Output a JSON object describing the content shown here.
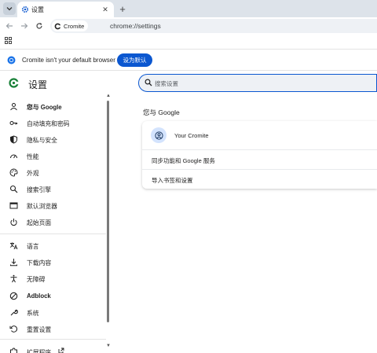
{
  "tabstrip": {
    "menu_icon": "chevron-down-icon",
    "tab_title": "设置",
    "tab_icon": "gear-icon",
    "close_icon": "close-icon",
    "new_tab_symbol": "+"
  },
  "toolbar": {
    "back_icon": "arrow-left-icon",
    "forward_icon": "arrow-right-icon",
    "reload_icon": "reload-icon",
    "site_chip_label": "Cromite",
    "url": "chrome://settings"
  },
  "bookmarks": {
    "apps_icon": "apps-grid-icon"
  },
  "banner": {
    "text": "Cromite isn't your default browser",
    "button_label": "设为默认"
  },
  "header": {
    "title": "设置",
    "search_placeholder": "搜索设置"
  },
  "sidebar": {
    "items": [
      {
        "label": "您与 Google",
        "icon": "person-icon",
        "bold": true
      },
      {
        "label": "自动填充和密码",
        "icon": "key-icon"
      },
      {
        "label": "隐私与安全",
        "icon": "shield-icon"
      },
      {
        "label": "性能",
        "icon": "speedometer-icon"
      },
      {
        "label": "外观",
        "icon": "palette-icon"
      },
      {
        "label": "搜索引擎",
        "icon": "search-icon"
      },
      {
        "label": "默认浏览器",
        "icon": "browser-window-icon"
      },
      {
        "label": "起始页面",
        "icon": "power-icon"
      },
      {
        "label": "语言",
        "icon": "translate-icon"
      },
      {
        "label": "下载内容",
        "icon": "download-icon"
      },
      {
        "label": "无障碍",
        "icon": "accessibility-icon"
      },
      {
        "label": "Adblock",
        "icon": "block-icon",
        "bold": true
      },
      {
        "label": "系统",
        "icon": "wrench-icon"
      },
      {
        "label": "重置设置",
        "icon": "reset-icon"
      },
      {
        "label": "扩展程序",
        "icon": "extension-icon"
      }
    ]
  },
  "main": {
    "section_title": "您与 Google",
    "account_name": "Your Cromite",
    "rows": [
      {
        "label": "同步功能和 Google 服务"
      },
      {
        "label": "导入书签和设置"
      }
    ]
  },
  "colors": {
    "accent": "#0b57d0",
    "tabstrip_bg": "#dde3ea",
    "omnibox_bg": "#eef1f5",
    "avatar_bg": "#d3e3fd"
  }
}
